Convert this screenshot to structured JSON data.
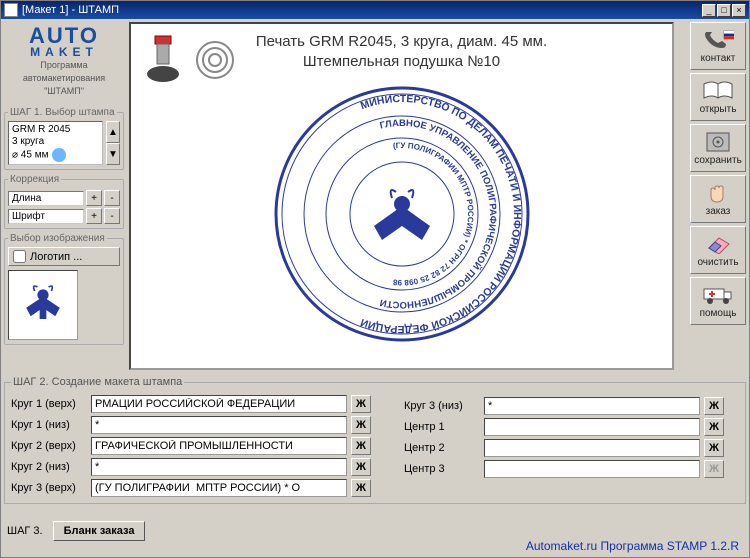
{
  "title": "[Макет 1] - ШТАМП",
  "logo": {
    "line1": "AUTO",
    "line2": "MAKET",
    "sub1": "Программа",
    "sub2": "автомакетирования",
    "sub3": "\"ШТАМП\""
  },
  "step1": {
    "legend": "ШАГ 1. Выбор штампа",
    "model": "GRM R 2045",
    "rings": "3 круга",
    "diam": "⌀ 45 мм"
  },
  "correction": {
    "legend": "Коррекция",
    "row1": "Длина",
    "row2": "Шрифт"
  },
  "imgsel": {
    "legend": "Выбор изображения",
    "btn": "Логотип ..."
  },
  "canvas": {
    "header1": "Печать GRM R2045, 3 круга, диам. 45 мм.",
    "header2": "Штемпельная подушка №10",
    "ring1_top": "МИНИСТЕРСТВО ПО ДЕЛАМ ПЕЧАТИ И ИНФОРМАЦИИ РОССИЙСКОЙ ФЕДЕРАЦИИ",
    "ring2_top": "ГЛАВНОЕ УПРАВЛЕНИЕ ПОЛИГРАФИЧЕСКОЙ ПРОМЫШЛЕННОСТИ",
    "ring3_top": "(ГУ ПОЛИГРАФИИ МПТР РОССИИ) * ОГРН 72 82 25 098 98"
  },
  "rightbar": {
    "b1": "контакт",
    "b2": "открыть",
    "b3": "сохранить",
    "b4": "заказ",
    "b5": "очистить",
    "b6": "помощь"
  },
  "step2": {
    "legend": "ШАГ 2. Создание макета штампа",
    "labels": {
      "k1t": "Круг 1 (верх)",
      "k1b": "Круг 1 (низ)",
      "k2t": "Круг 2 (верх)",
      "k2b": "Круг 2 (низ)",
      "k3t": "Круг 3 (верх)",
      "k3b": "Круг 3 (низ)",
      "c1": "Центр 1",
      "c2": "Центр 2",
      "c3": "Центр 3"
    },
    "values": {
      "k1t": "РМАЦИИ РОССИЙСКОЙ ФЕДЕРАЦИИ",
      "k1b": "*",
      "k2t": "ГРАФИЧЕСКОЙ ПРОМЫШЛЕННОСТИ",
      "k2b": "*",
      "k3t": "(ГУ ПОЛИГРАФИИ  МПТР РОССИИ) * О",
      "k3b": "*",
      "c1": "",
      "c2": "",
      "c3": ""
    },
    "bold": "Ж"
  },
  "step3": {
    "label": "ШАГ 3.",
    "btn": "Бланк заказа"
  },
  "footer": "Automaket.ru Программа STAMP 1.2.R",
  "colors": {
    "stampBlue": "#2a3a9a"
  }
}
